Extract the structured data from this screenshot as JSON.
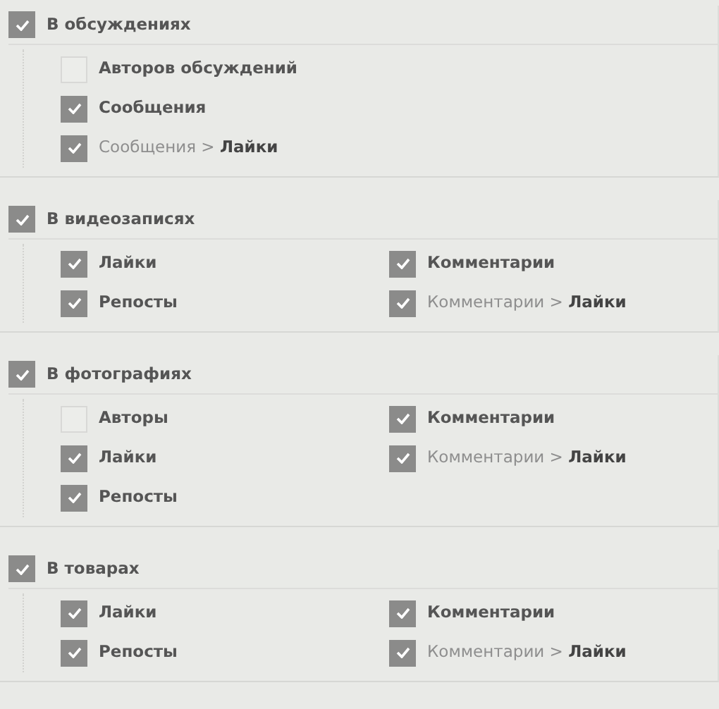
{
  "sections": [
    {
      "title": "В обсуждениях",
      "checked": true,
      "columns": [
        [
          {
            "label": "Авторов обсуждений",
            "kind": "plain",
            "checked": false
          },
          {
            "label": "Сообщения",
            "kind": "plain",
            "checked": true
          },
          {
            "label": "Сообщения > **Лайки**",
            "kind": "path",
            "checked": true
          }
        ]
      ]
    },
    {
      "title": "В видеозаписях",
      "checked": true,
      "columns": [
        [
          {
            "label": "Лайки",
            "kind": "plain",
            "checked": true
          },
          {
            "label": "Репосты",
            "kind": "plain",
            "checked": true
          }
        ],
        [
          {
            "label": "Комментарии",
            "kind": "plain",
            "checked": true
          },
          {
            "label": "Комментарии > **Лайки**",
            "kind": "path",
            "checked": true
          }
        ]
      ]
    },
    {
      "title": "В фотографиях",
      "checked": true,
      "columns": [
        [
          {
            "label": "Авторы",
            "kind": "plain",
            "checked": false
          },
          {
            "label": "Лайки",
            "kind": "plain",
            "checked": true
          },
          {
            "label": "Репосты",
            "kind": "plain",
            "checked": true
          }
        ],
        [
          {
            "label": "Комментарии",
            "kind": "plain",
            "checked": true
          },
          {
            "label": "Комментарии > **Лайки**",
            "kind": "path",
            "checked": true
          }
        ]
      ]
    },
    {
      "title": "В товарах",
      "checked": true,
      "columns": [
        [
          {
            "label": "Лайки",
            "kind": "plain",
            "checked": true
          },
          {
            "label": "Репосты",
            "kind": "plain",
            "checked": true
          }
        ],
        [
          {
            "label": "Комментарии",
            "kind": "plain",
            "checked": true
          },
          {
            "label": "Комментарии > **Лайки**",
            "kind": "path",
            "checked": true
          }
        ]
      ]
    }
  ]
}
